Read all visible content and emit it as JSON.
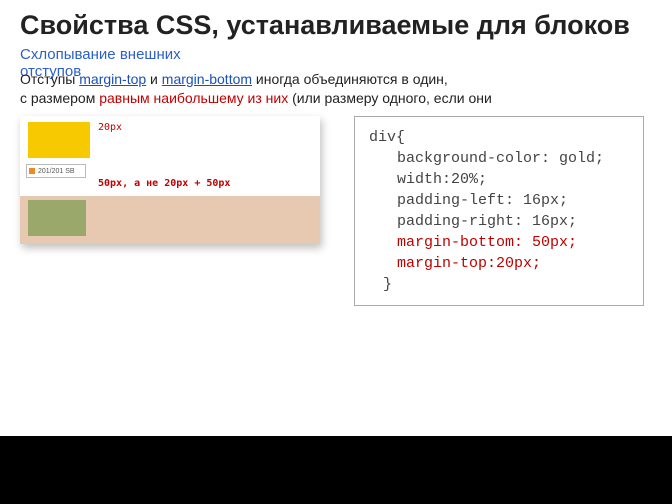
{
  "title": "Свойства CSS, устанавливаемые для блоков",
  "subtitle": {
    "line1": "Схлопывание внешних",
    "line2": "отступов"
  },
  "para": {
    "pre1": "Отступы ",
    "link1": "margin-top",
    "mid1": " и ",
    "link2": "margin-bottom",
    "mid2": " иногда объединяются в один,",
    "line2a": " с размером ",
    "emph": "равным наибольшему из них",
    "line2b": " (или размеру одного, если они"
  },
  "illus": {
    "top_label": "20px",
    "mid_label": "50px, а не 20px + 50px",
    "badge": "201/201 SB"
  },
  "code": {
    "l1": "div{",
    "l2": "background-color: gold;",
    "l3": "width:20%;",
    "l4": "padding-left: 16px;",
    "l5": "padding-right: 16px;",
    "l6": "margin-bottom: 50px;",
    "l7": "margin-top:20px;",
    "l8": "}"
  }
}
